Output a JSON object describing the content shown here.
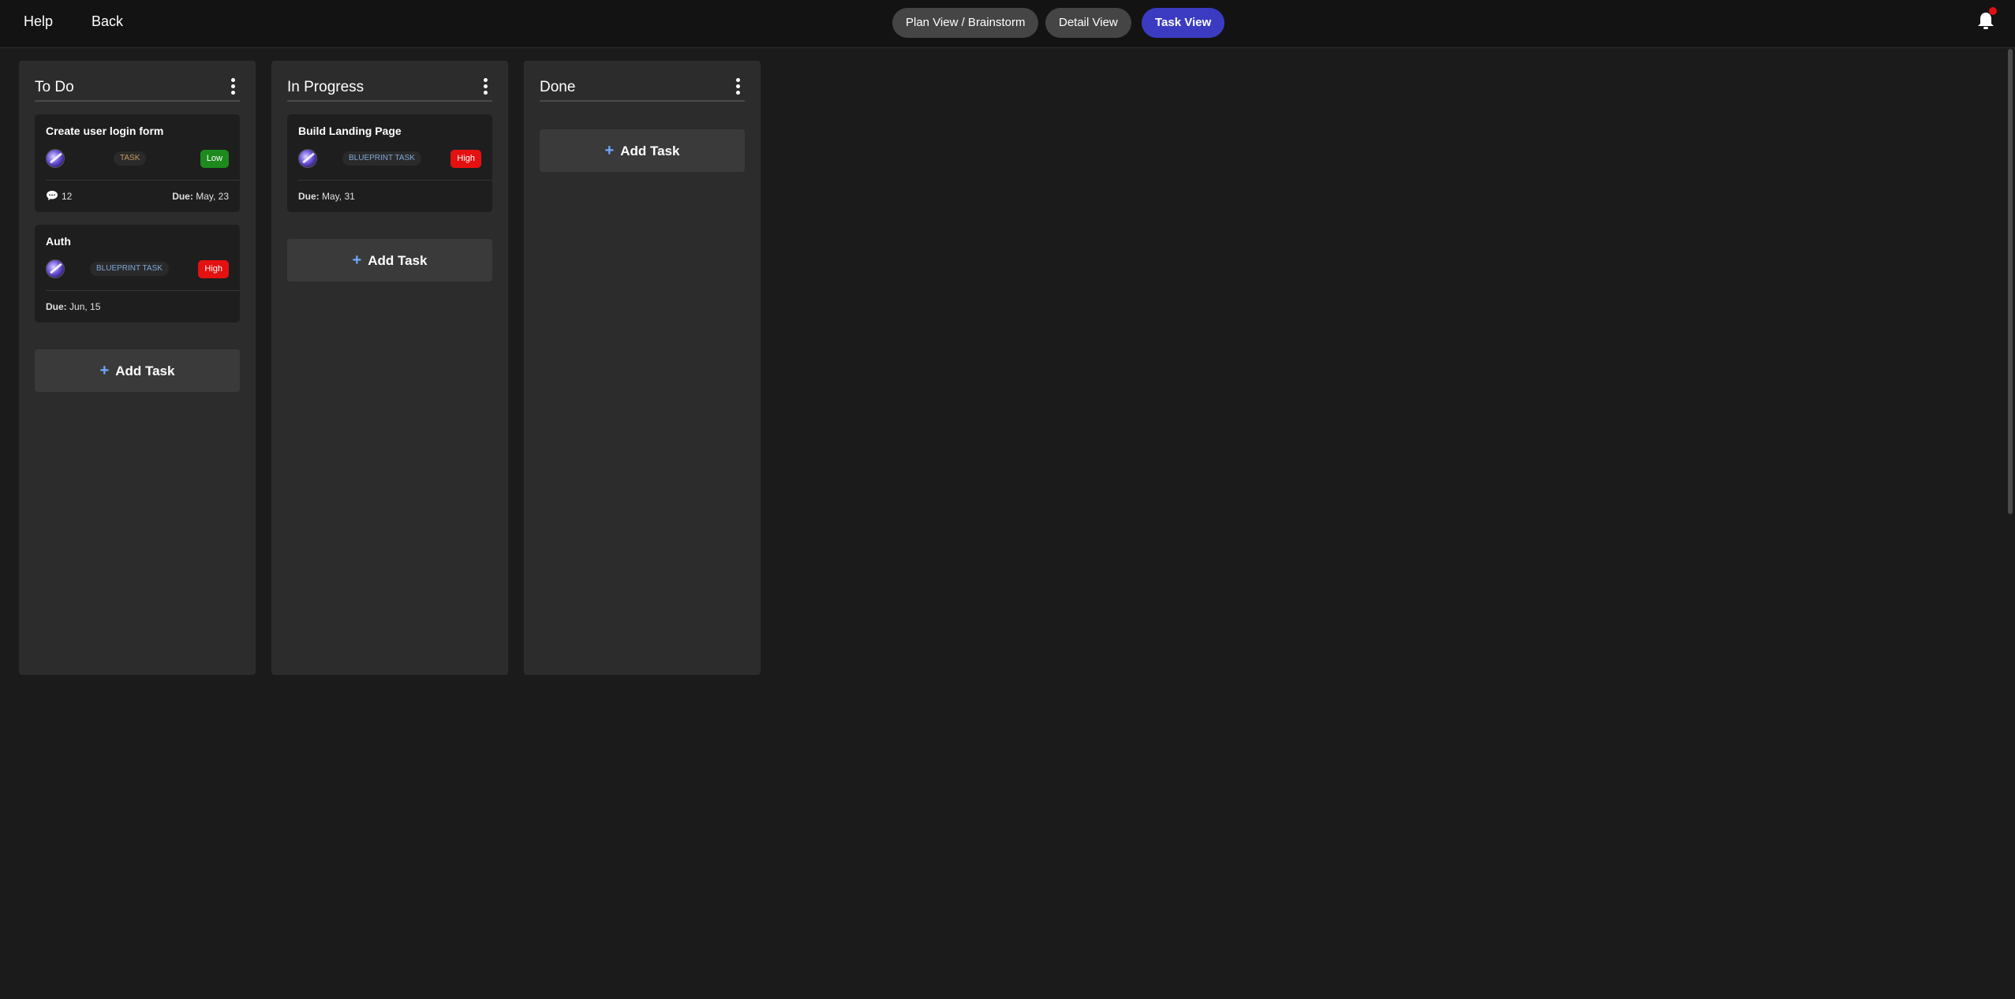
{
  "nav": {
    "help": "Help",
    "back": "Back"
  },
  "views": {
    "plan": "Plan View / Brainstorm",
    "detail": "Detail View",
    "task": "Task View",
    "active": "Task View",
    "active_color": "#3b3bc2"
  },
  "notifications": {
    "icon": "bell-icon",
    "has_unread": true,
    "dot_color": "#e01010"
  },
  "add_task_label": "Add Task",
  "columns": [
    {
      "title": "To Do",
      "cards": [
        {
          "title": "Create user login form",
          "type": "TASK",
          "priority": "Low",
          "comments": "12",
          "due_label": "Due:",
          "due_value": "May, 23"
        },
        {
          "title": "Auth",
          "type": "BLUEPRINT TASK",
          "priority": "High",
          "due_label": "Due:",
          "due_value": "Jun, 15"
        }
      ]
    },
    {
      "title": "In Progress",
      "cards": [
        {
          "title": "Build Landing Page",
          "type": "BLUEPRINT TASK",
          "priority": "High",
          "due_label": "Due:",
          "due_value": "May, 31"
        }
      ]
    },
    {
      "title": "Done",
      "cards": []
    }
  ],
  "colors": {
    "priority_low": "#1c8a1c",
    "priority_high": "#e51010",
    "task_type_text": "#c79a62",
    "blueprint_type_text": "#7fa6d8"
  }
}
